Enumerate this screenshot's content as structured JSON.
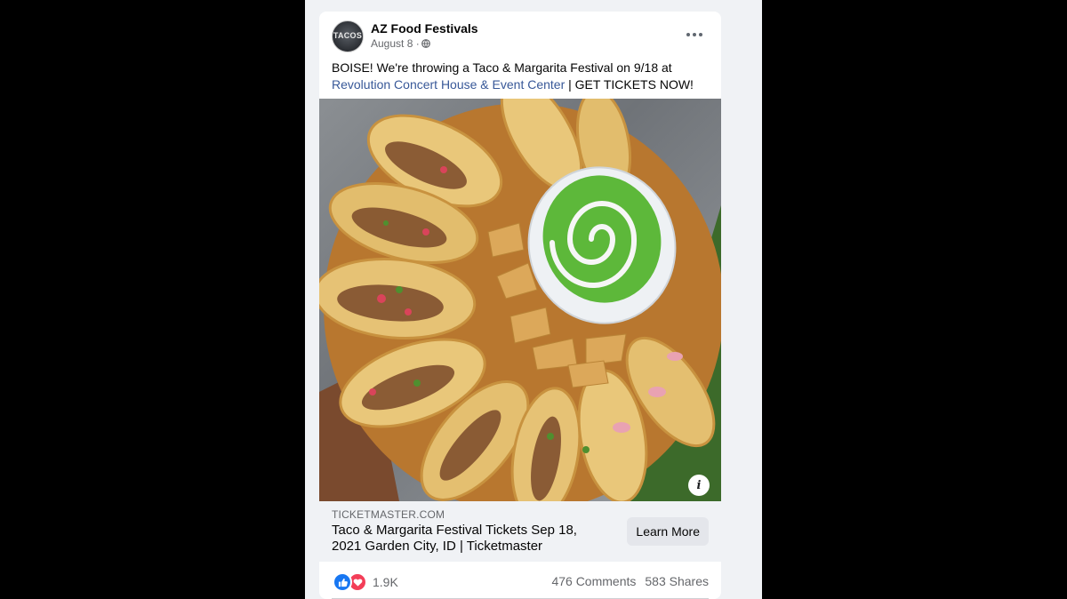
{
  "post": {
    "author": "AZ Food Festivals",
    "avatar_text": "TACOS",
    "date": "August 8 ·",
    "privacy_icon": "globe-icon",
    "text_before_link": "BOISE! We're throwing a Taco & Margarita Festival on 9/18 at ",
    "link_text": "Revolution Concert House & Event Center",
    "text_after_link": " |  GET TICKETS NOW!",
    "more_icon": "more-options-icon"
  },
  "link_preview": {
    "domain": "TICKETMASTER.COM",
    "headline": "Taco & Margarita Festival Tickets Sep 18, 2021 Garden City, ID | Ticketmaster",
    "cta_label": "Learn More",
    "info_label": "i"
  },
  "stats": {
    "reaction_icons": [
      "like-icon",
      "love-icon"
    ],
    "reactions_count": "1.9K",
    "comments": "476 Comments",
    "shares": "583 Shares"
  },
  "colors": {
    "link": "#385898",
    "like": "#1877f2",
    "love": "#f33e58",
    "feed_bg": "#f0f2f5"
  }
}
